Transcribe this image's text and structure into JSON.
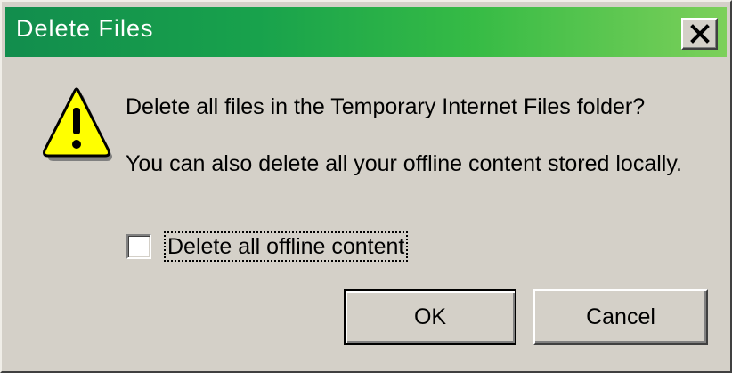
{
  "window": {
    "title": "Delete Files",
    "close_icon": "close-x-icon"
  },
  "message": {
    "icon": "warning-icon",
    "primary": "Delete all files in the Temporary Internet Files folder?",
    "secondary": "You can also delete all your offline content stored locally."
  },
  "checkbox": {
    "label": "Delete all offline content",
    "checked": false
  },
  "buttons": {
    "ok": "OK",
    "cancel": "Cancel"
  },
  "colors": {
    "titlebar_start": "#128d4d",
    "titlebar_end": "#7cd05a",
    "face": "#d4d0c8",
    "warning_fill": "#ffff00"
  }
}
